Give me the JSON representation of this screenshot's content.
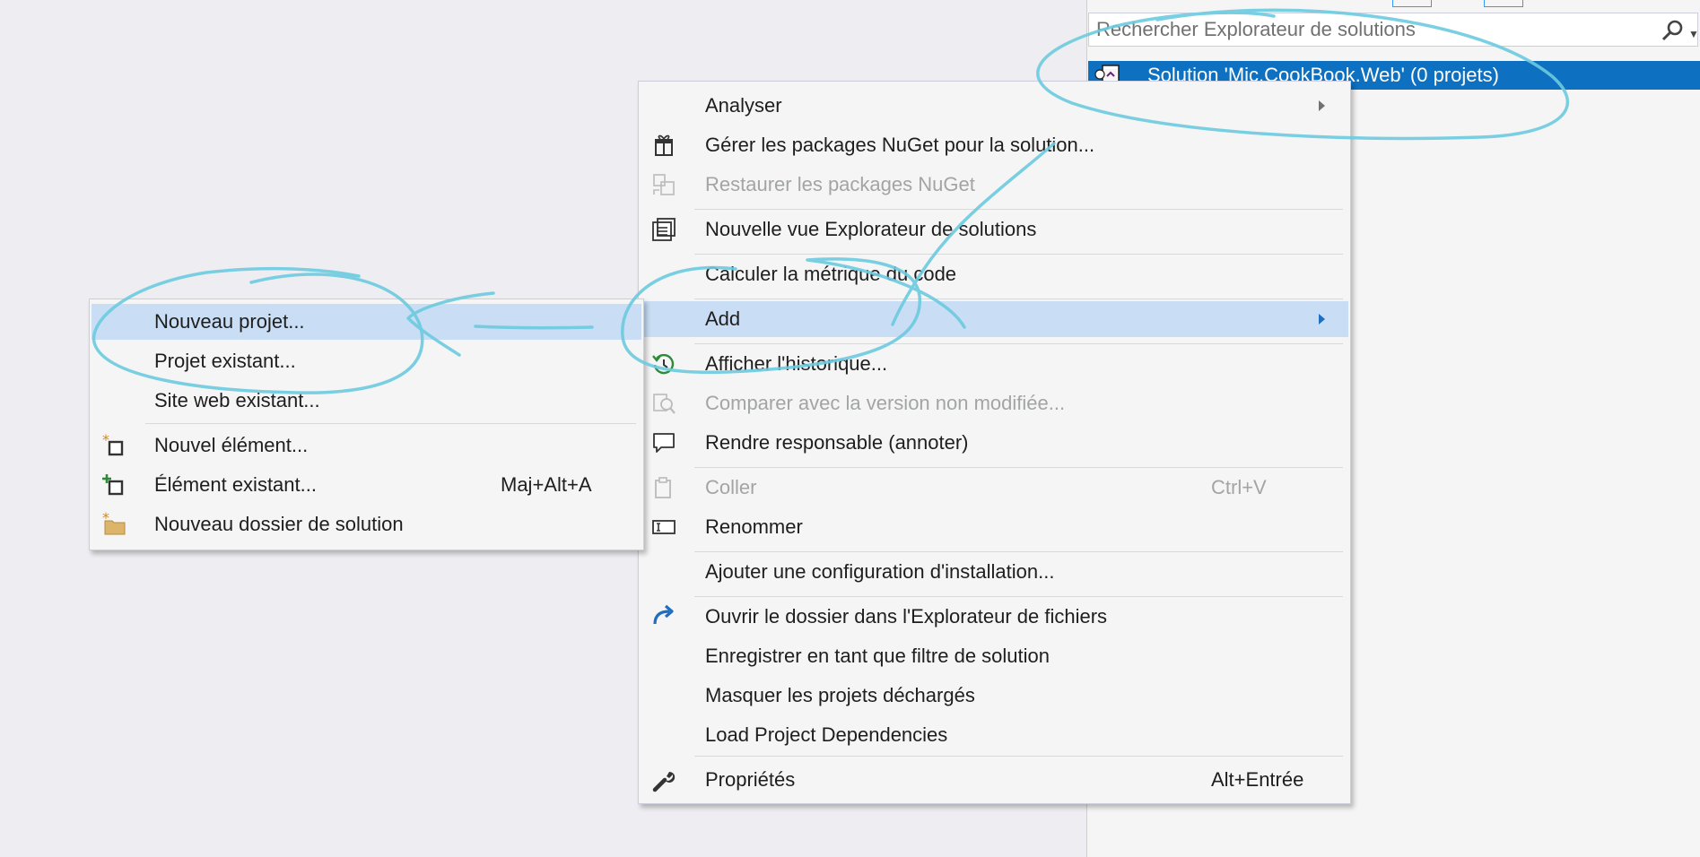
{
  "solution_explorer": {
    "search_placeholder": "Rechercher Explorateur de solutions",
    "tree_item": "Solution 'Mic.CookBook.Web' (0 projets)"
  },
  "main_menu": {
    "items": [
      {
        "label": "Analyser",
        "icon": "none",
        "submenu": true
      },
      {
        "label": "Gérer les packages NuGet pour la solution...",
        "icon": "nuget-gift-icon"
      },
      {
        "label": "Restaurer les packages NuGet",
        "icon": "restore-packages-icon",
        "disabled": true
      },
      {
        "label": "Nouvelle vue Explorateur de solutions",
        "icon": "new-solution-view-icon"
      },
      {
        "label": "Calculer la métrique du code",
        "icon": "none"
      },
      {
        "label": "Add",
        "icon": "none",
        "submenu": true,
        "highlighted": true
      },
      {
        "label": "Afficher l'historique...",
        "icon": "history-icon"
      },
      {
        "label": "Comparer avec la version non modifiée...",
        "icon": "compare-icon",
        "disabled": true
      },
      {
        "label": "Rendre responsable (annoter)",
        "icon": "annotate-bubble-icon"
      },
      {
        "label": "Coller",
        "icon": "paste-icon",
        "disabled": true,
        "shortcut": "Ctrl+V"
      },
      {
        "label": "Renommer",
        "icon": "rename-icon"
      },
      {
        "label": "Ajouter une configuration d'installation...",
        "icon": "none"
      },
      {
        "label": "Ouvrir le dossier dans l'Explorateur de fichiers",
        "icon": "open-folder-arrow-icon"
      },
      {
        "label": "Enregistrer en tant que filtre de solution",
        "icon": "none"
      },
      {
        "label": "Masquer les projets déchargés",
        "icon": "none"
      },
      {
        "label": "Load Project Dependencies",
        "icon": "none"
      },
      {
        "label": "Propriétés",
        "icon": "wrench-icon",
        "shortcut": "Alt+Entrée"
      }
    ]
  },
  "sub_menu": {
    "items": [
      {
        "label": "Nouveau projet...",
        "highlighted": true
      },
      {
        "label": "Projet existant..."
      },
      {
        "label": "Site web existant..."
      },
      {
        "label": "Nouvel élément...",
        "icon": "new-item-icon"
      },
      {
        "label": "Élément existant...",
        "icon": "existing-item-icon",
        "shortcut": "Maj+Alt+A"
      },
      {
        "label": "Nouveau dossier de solution",
        "icon": "new-solution-folder-icon"
      }
    ]
  },
  "colors": {
    "selection_blue": "#0e70c0",
    "menu_highlight": "#c9def5",
    "ink_annotation": "#6ccbdf",
    "disabled_text": "#a2a4a5"
  }
}
